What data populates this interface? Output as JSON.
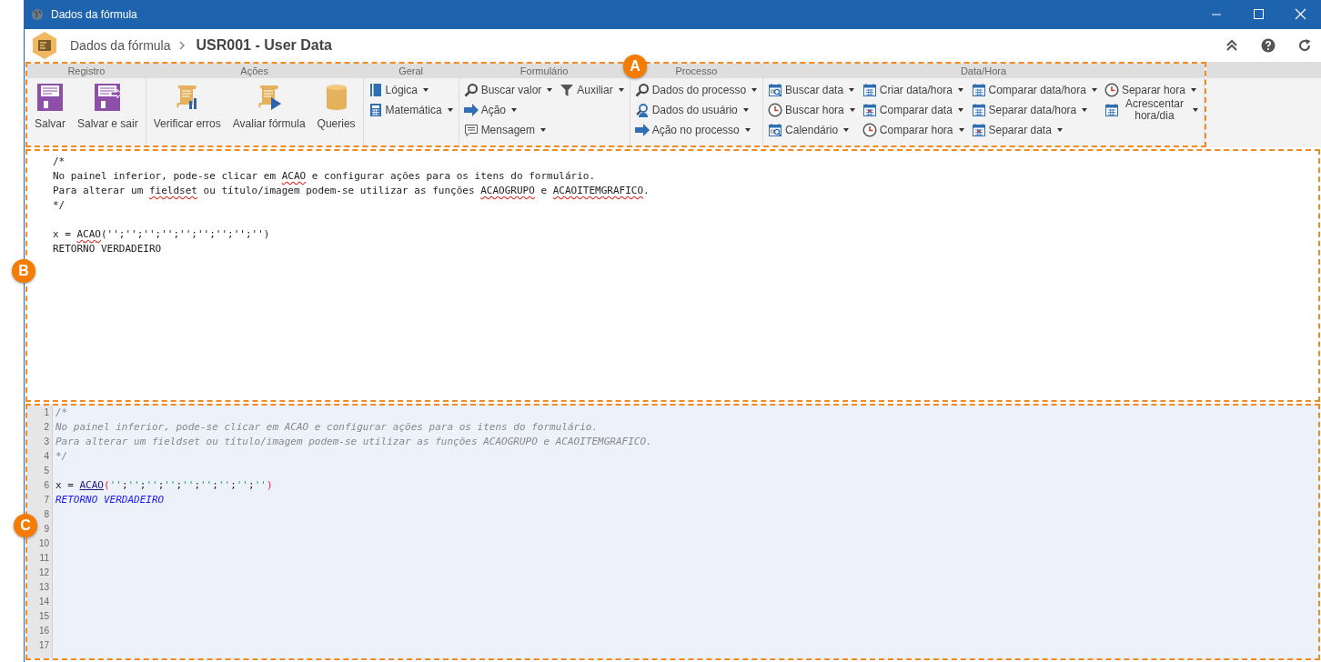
{
  "window": {
    "title": "Dados da fórmula"
  },
  "header": {
    "breadcrumb": "Dados da fórmula",
    "title": "USR001 - User Data"
  },
  "ribbon": [
    {
      "title": "Registro",
      "columns": [
        [
          {
            "kind": "save",
            "label": "Salvar"
          }
        ],
        [
          {
            "kind": "save-exit",
            "label": "Salvar e sair"
          }
        ]
      ]
    },
    {
      "title": "Ações",
      "columns": [
        [
          {
            "kind": "scroll-chart",
            "label": "Verificar erros"
          }
        ],
        [
          {
            "kind": "scroll-play",
            "label": "Avaliar fórmula"
          }
        ],
        [
          {
            "kind": "database",
            "label": "Queries"
          }
        ]
      ]
    },
    {
      "title": "Geral",
      "columns": [
        [
          {
            "kind": "book",
            "label": "Lógica"
          },
          {
            "kind": "calculator",
            "label": "Matemática"
          }
        ]
      ]
    },
    {
      "title": "Formulário",
      "columns": [
        [
          {
            "kind": "magnifier",
            "label": "Buscar valor"
          },
          {
            "kind": "arrow",
            "label": "Ação"
          },
          {
            "kind": "message",
            "label": "Mensagem"
          }
        ],
        [
          {
            "kind": "funnel",
            "label": "Auxiliar"
          }
        ]
      ]
    },
    {
      "title": "Processo",
      "columns": [
        [
          {
            "kind": "magnifier",
            "label": "Dados do processo"
          },
          {
            "kind": "user-search",
            "label": "Dados do usuário"
          },
          {
            "kind": "arrow",
            "label": "Ação no processo"
          }
        ]
      ]
    },
    {
      "title": "Data/Hora",
      "columns": [
        [
          {
            "kind": "calendar-search",
            "label": "Buscar data"
          },
          {
            "kind": "clock",
            "label": "Buscar hora"
          },
          {
            "kind": "calendar-search",
            "label": "Calendário"
          }
        ],
        [
          {
            "kind": "calendar",
            "label": "Criar data/hora"
          },
          {
            "kind": "calendar-red",
            "label": "Comparar data"
          },
          {
            "kind": "clock",
            "label": "Comparar hora"
          }
        ],
        [
          {
            "kind": "calendar",
            "label": "Comparar data/hora"
          },
          {
            "kind": "calendar",
            "label": "Separar data/hora"
          },
          {
            "kind": "calendar-red",
            "label": "Separar data"
          }
        ],
        [
          {
            "kind": "clock",
            "label": "Separar hora"
          },
          {
            "kind": "calendar",
            "label": "Acrescentar hora/dia"
          }
        ]
      ]
    }
  ],
  "text_editor": {
    "blocks": [
      [
        {
          "segments": [
            {
              "text": "/*",
              "misspelled": false
            }
          ]
        },
        {
          "segments": [
            {
              "text": "No painel inferior, pode-se clicar em ",
              "misspelled": false
            },
            {
              "text": "ACAO",
              "misspelled": true
            },
            {
              "text": " e configurar ações para os itens do formulário.",
              "misspelled": false
            }
          ]
        },
        {
          "segments": [
            {
              "text": "Para alterar um ",
              "misspelled": false
            },
            {
              "text": "fieldset",
              "misspelled": true
            },
            {
              "text": " ou título/imagem podem-se utilizar as funções ",
              "misspelled": false
            },
            {
              "text": "ACAOGRUPO",
              "misspelled": true
            },
            {
              "text": " e ",
              "misspelled": false
            },
            {
              "text": "ACAOITEMGRAFICO",
              "misspelled": true
            },
            {
              "text": ".",
              "misspelled": false
            }
          ]
        },
        {
          "segments": [
            {
              "text": "*/",
              "misspelled": false
            }
          ]
        }
      ],
      [
        {
          "segments": [
            {
              "text": "x = ",
              "misspelled": false
            },
            {
              "text": "ACAO",
              "misspelled": true
            },
            {
              "text": "('';'';'';'';'';'';'';'';'')",
              "misspelled": false
            }
          ]
        },
        {
          "segments": [
            {
              "text": "RETORNO VERDADEIRO",
              "misspelled": false
            }
          ]
        }
      ]
    ]
  },
  "code_editor": {
    "line_numbers": [
      "1",
      "2",
      "3",
      "4",
      "5",
      "6",
      "7",
      "8",
      "9",
      "10",
      "11",
      "12",
      "13",
      "14",
      "15",
      "16",
      "17"
    ],
    "blocks": [
      [
        {
          "segments": [
            {
              "kind": "comment",
              "text": "/*"
            }
          ]
        },
        {
          "segments": [
            {
              "kind": "comment",
              "text": "No painel inferior, pode-se clicar em ACAO e configurar ações para os itens do formulário."
            }
          ]
        },
        {
          "segments": [
            {
              "kind": "comment",
              "text": "Para alterar um fieldset ou título/imagem podem-se utilizar as funções ACAOGRUPO e ACAOITEMGRAFICO."
            }
          ]
        },
        {
          "segments": [
            {
              "kind": "comment",
              "text": "*/"
            }
          ]
        }
      ],
      [
        {
          "segments": [
            {
              "kind": "plain",
              "text": "x = "
            },
            {
              "kind": "function",
              "text": "ACAO"
            },
            {
              "kind": "paren",
              "text": "("
            },
            {
              "kind": "string",
              "text": "''"
            },
            {
              "kind": "plain",
              "text": ";"
            },
            {
              "kind": "string",
              "text": "''"
            },
            {
              "kind": "plain",
              "text": ";"
            },
            {
              "kind": "string",
              "text": "''"
            },
            {
              "kind": "plain",
              "text": ";"
            },
            {
              "kind": "string",
              "text": "''"
            },
            {
              "kind": "plain",
              "text": ";"
            },
            {
              "kind": "string",
              "text": "''"
            },
            {
              "kind": "plain",
              "text": ";"
            },
            {
              "kind": "string",
              "text": "''"
            },
            {
              "kind": "plain",
              "text": ";"
            },
            {
              "kind": "string",
              "text": "''"
            },
            {
              "kind": "plain",
              "text": ";"
            },
            {
              "kind": "string",
              "text": "''"
            },
            {
              "kind": "plain",
              "text": ";"
            },
            {
              "kind": "string",
              "text": "''"
            },
            {
              "kind": "paren",
              "text": ")"
            }
          ]
        },
        {
          "segments": [
            {
              "kind": "keyword",
              "text": "RETORNO VERDADEIRO"
            }
          ]
        }
      ]
    ]
  },
  "callouts": [
    {
      "label": "A"
    },
    {
      "label": "B"
    },
    {
      "label": "C"
    }
  ]
}
